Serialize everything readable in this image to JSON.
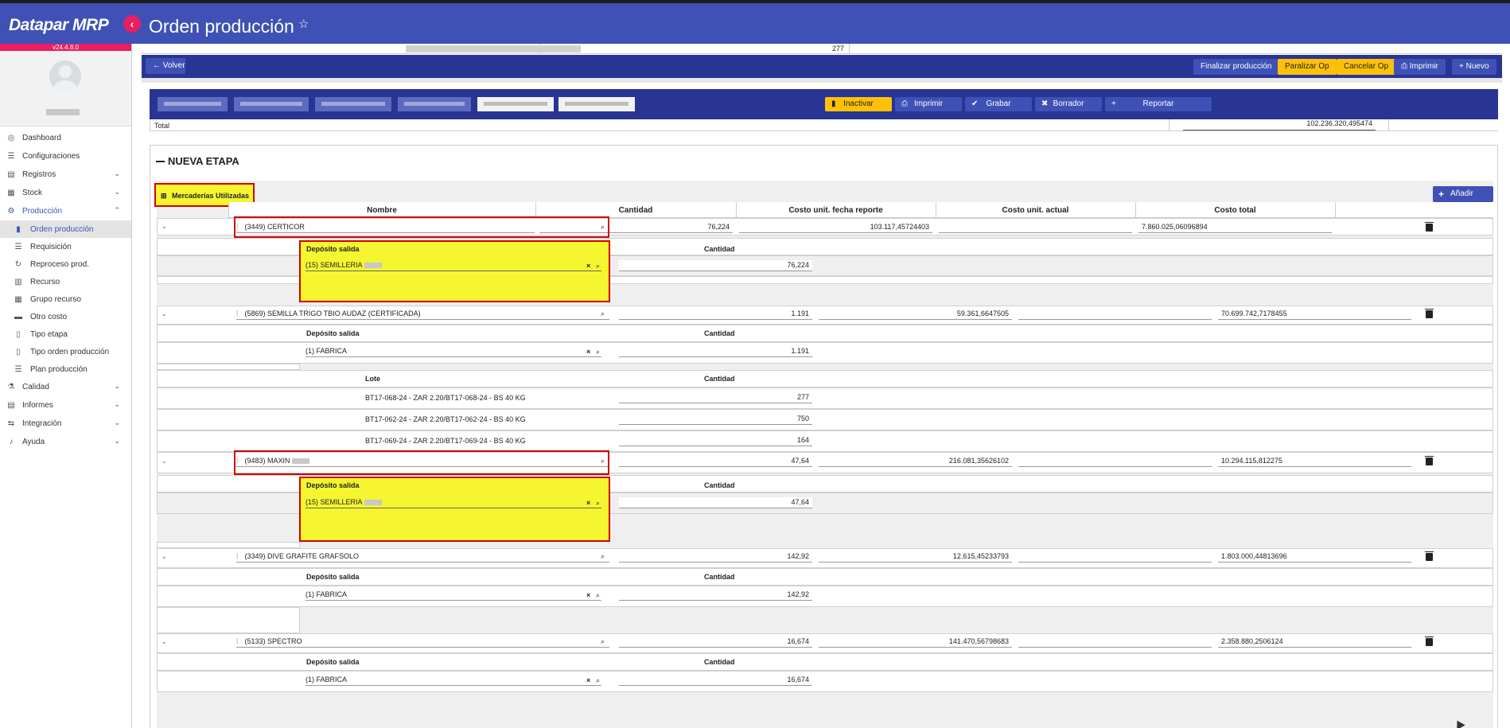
{
  "app": {
    "brand": "Datapar MRP",
    "version": "v24.4.8.0",
    "page_title": "Orden producción"
  },
  "sidebar": {
    "items": [
      {
        "label": "Dashboard"
      },
      {
        "label": "Configuraciones"
      },
      {
        "label": "Registros"
      },
      {
        "label": "Stock"
      },
      {
        "label": "Producción"
      },
      {
        "label": "Calidad"
      },
      {
        "label": "Informes"
      },
      {
        "label": "Integración"
      },
      {
        "label": "Ayuda"
      }
    ],
    "produccion_sub": [
      {
        "label": "Orden producción"
      },
      {
        "label": "Requisición"
      },
      {
        "label": "Reproceso prod."
      },
      {
        "label": "Recurso"
      },
      {
        "label": "Grupo recurso"
      },
      {
        "label": "Otro costo"
      },
      {
        "label": "Tipo etapa"
      },
      {
        "label": "Tipo orden producción"
      },
      {
        "label": "Plan producción"
      }
    ]
  },
  "top": {
    "partial_value": "277",
    "back": "Volver",
    "finalizar": "Finalizar producción",
    "paralizar": "Paralizar Op",
    "cancelar": "Cancelar Op",
    "imprimir": "Imprimir",
    "nuevo": "Nuevo"
  },
  "actions": {
    "inactivar": "Inactivar",
    "imprimir": "Imprimir",
    "grabar": "Grabar",
    "borrador": "Borrador",
    "reportar": "Reportar"
  },
  "total": {
    "label": "Total",
    "value": "102.236.320,495474"
  },
  "section": {
    "title": "NUEVA ETAPA",
    "tab_button": "Mercaderías Utilizadas",
    "add_button": "Añadir",
    "columns": [
      "Nombre",
      "Cantidad",
      "Costo unit. fecha reporte",
      "Costo unit. actual",
      "Costo total"
    ],
    "deposito_label": "Depósito salida",
    "cantidad_label": "Cantidad",
    "lote_label": "Lote"
  },
  "items": [
    {
      "name": "(3449) CERTICOR",
      "qty": "76,224",
      "unit_cost": "103.117,45724403",
      "total": "7.860.025,06096894",
      "deposito": "(15) SEMILLERIA",
      "dep_qty": "76,224"
    },
    {
      "name": "(5869) SEMILLA TRIGO TBIO AUDAZ (CERTIFICADA)",
      "qty": "1.191",
      "unit_cost": "59.361,6647505",
      "total": "70.699.742,7178455",
      "deposito": "(1) FABRICA",
      "dep_qty": "1.191",
      "lotes": [
        {
          "lote": "BT17-068-24 - ZAR 2.20/BT17-068-24 - BS 40 KG",
          "qty": "277"
        },
        {
          "lote": "BT17-062-24 - ZAR 2.20/BT17-062-24 - BS 40 KG",
          "qty": "750"
        },
        {
          "lote": "BT17-069-24 - ZAR 2.20/BT17-069-24 - BS 40 KG",
          "qty": "164"
        }
      ]
    },
    {
      "name": "(9483) MAXIN",
      "qty": "47,64",
      "unit_cost": "216.081,35626102",
      "total": "10.294.115,812275",
      "deposito": "(15) SEMILLERIA",
      "dep_qty": "47,64"
    },
    {
      "name": "(3349) DIVE GRAFITE GRAFSOLO",
      "qty": "142,92",
      "unit_cost": "12.615,45233793",
      "total": "1.803.000,44813696",
      "deposito": "(1) FABRICA",
      "dep_qty": "142,92"
    },
    {
      "name": "(5133) SPECTRO",
      "qty": "16,674",
      "unit_cost": "141.470,56798683",
      "total": "2.358.880,2506124",
      "deposito": "(1) FABRICA",
      "dep_qty": "16,674"
    }
  ]
}
